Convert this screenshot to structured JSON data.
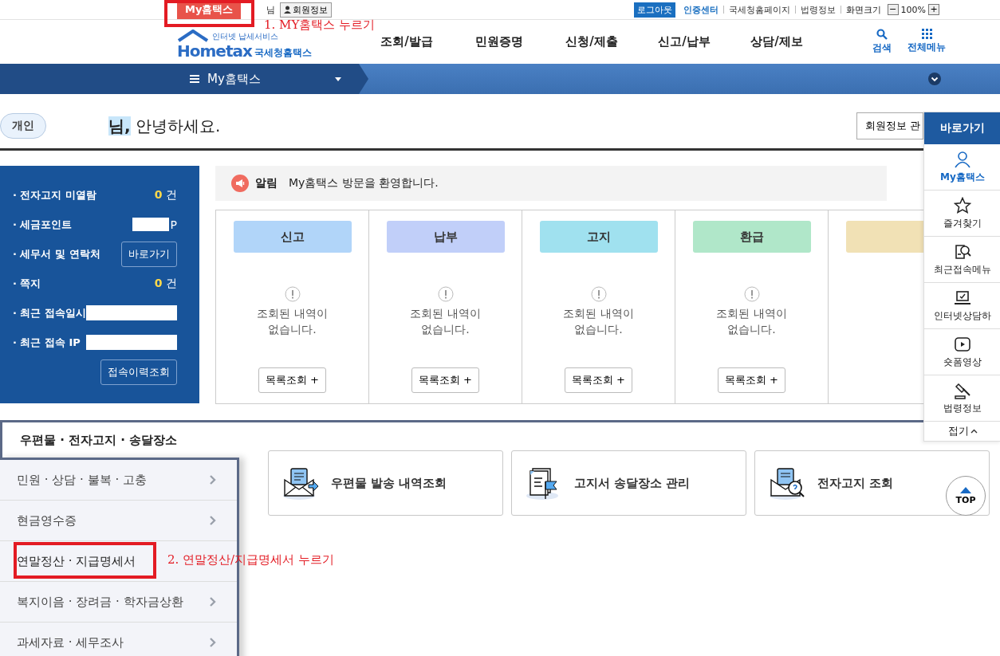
{
  "top_bar": {
    "my_button": "My홈택스",
    "user_suffix": "님",
    "member_button": "회원정보",
    "logout": "로그아웃",
    "links": [
      {
        "label": "인증센터",
        "kind": "strong"
      },
      {
        "label": "국세청홈페이지",
        "kind": "plain"
      },
      {
        "label": "법령정보",
        "kind": "plain"
      },
      {
        "label": "화면크기",
        "kind": "dark"
      }
    ],
    "zoom_minus": "−",
    "zoom_value": "100%",
    "zoom_plus": "+"
  },
  "header": {
    "logo_small": "인터넷 납세서비스",
    "logo_word": "Hometax",
    "logo_name": "국세청홈택스",
    "nav": [
      "조회/발급",
      "민원증명",
      "신청/제출",
      "신고/납부",
      "상담/제보"
    ],
    "search": "검색",
    "all_menu": "전체메뉴"
  },
  "menu_bar": {
    "title": "My홈택스"
  },
  "greeting": {
    "badge": "개인",
    "name_suffix": "님,",
    "text": "안녕하세요.",
    "member_button": "회원정보 관"
  },
  "summary_panel": [
    {
      "label": "· 전자고지 미열람",
      "kind": "count",
      "value": "0",
      "unit": "건"
    },
    {
      "label": "· 세금포인트",
      "kind": "points",
      "unit": "P"
    },
    {
      "label": "· 세무서 및 연락처",
      "kind": "button",
      "button": "바로가기"
    },
    {
      "label": "· 쪽지",
      "kind": "count",
      "value": "0",
      "unit": "건"
    },
    {
      "label": "· 최근 접속일시",
      "kind": "hidden"
    },
    {
      "label": "· 최근 접속 IP",
      "kind": "hidden"
    },
    {
      "kind": "button",
      "button": "접속이력조회"
    }
  ],
  "notice": {
    "label": "알림",
    "text": "My홈택스 방문을 환영합니다."
  },
  "status_cards": [
    {
      "label": "신고",
      "color": "#b1d5f9",
      "message": "조회된 내역이\n없습니다.",
      "button": "목록조회 +"
    },
    {
      "label": "납부",
      "color": "#c1cff9",
      "message": "조회된 내역이\n없습니다.",
      "button": "목록조회 +"
    },
    {
      "label": "고지",
      "color": "#a0e1ef",
      "message": "조회된 내역이\n없습니다.",
      "button": "목록조회 +"
    },
    {
      "label": "환급",
      "color": "#b0e7c9",
      "message": "조회된 내역이\n없습니다.",
      "button": "목록조회 +"
    },
    {
      "color": "#f1e1b5"
    }
  ],
  "section_tab": "우편물 · 전자고지 · 송달장소",
  "side_menu": [
    {
      "label": "민원 · 상담 · 불복 · 고충"
    },
    {
      "label": "현금영수증"
    },
    {
      "label": "연말정산 · 지급명세서",
      "highlighted": true
    },
    {
      "label": "복지이음 · 장려금 · 학자금상환"
    },
    {
      "label": "과세자료 · 세무조사"
    }
  ],
  "services": [
    {
      "label": "우편물 발송 내역조회",
      "kind": "mail"
    },
    {
      "label": "고지서 송달장소 관리",
      "kind": "document"
    },
    {
      "label": "전자고지 조회",
      "kind": "search"
    }
  ],
  "quick_menu": {
    "title": "바로가기",
    "items": [
      {
        "label": "My홈택스",
        "kind": "person",
        "selected": true
      },
      {
        "label": "즐겨찾기",
        "kind": "star",
        "selected": false
      },
      {
        "label": "최근접속메뉴",
        "kind": "recent",
        "selected": false
      },
      {
        "label": "인터넷상담하",
        "kind": "laptop",
        "selected": false
      },
      {
        "label": "숏폼영상",
        "kind": "video",
        "selected": false
      },
      {
        "label": "법령정보",
        "kind": "gavel",
        "selected": false
      }
    ],
    "fold": "접기"
  },
  "top_button": "TOP",
  "annotations": [
    "1. MY홈택스 누르기",
    "2. 연말정산/지급명세서 누르기"
  ]
}
